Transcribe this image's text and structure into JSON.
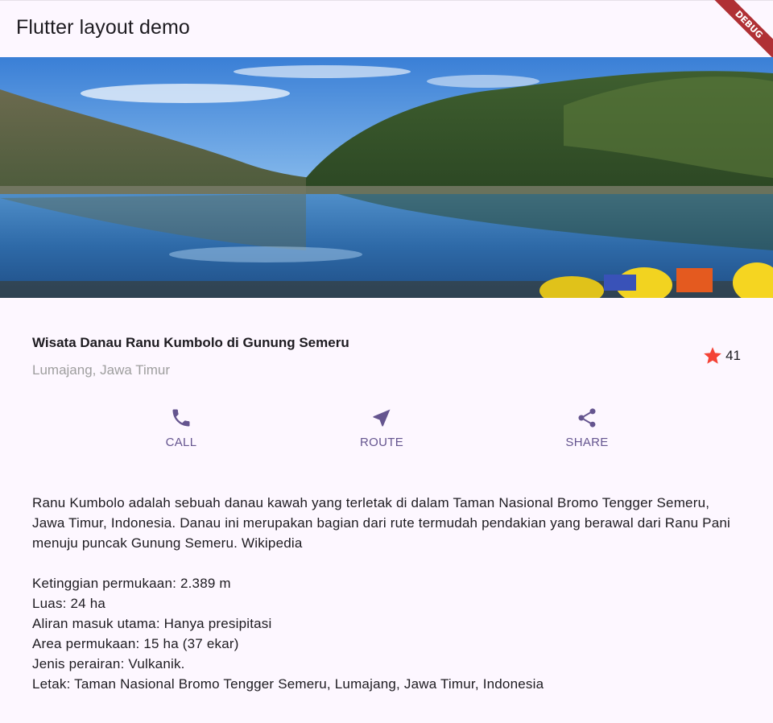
{
  "app": {
    "title": "Flutter layout demo",
    "debug_label": "DEBUG"
  },
  "hero": {
    "image_label": "lake-photo"
  },
  "place": {
    "name": "Wisata Danau Ranu Kumbolo di Gunung Semeru",
    "location": "Lumajang, Jawa Timur",
    "rating_count": "41",
    "star_color": "#f44336"
  },
  "actions": [
    {
      "icon": "phone-icon",
      "label": "CALL"
    },
    {
      "icon": "navigation-icon",
      "label": "ROUTE"
    },
    {
      "icon": "share-icon",
      "label": "SHARE"
    }
  ],
  "accent_color": "#65558f",
  "description": {
    "intro": "Ranu Kumbolo adalah sebuah danau kawah yang terletak di dalam Taman Nasional Bromo Tengger Semeru, Jawa Timur, Indonesia. Danau ini merupakan bagian dari rute termudah pendakian yang berawal dari Ranu Pani menuju puncak Gunung Semeru. Wikipedia",
    "facts": [
      "Ketinggian permukaan: 2.389 m",
      "Luas: 24 ha",
      "Aliran masuk utama: Hanya presipitasi",
      "Area permukaan: 15 ha (37 ekar)",
      "Jenis perairan: Vulkanik.",
      "Letak: Taman Nasional Bromo Tengger Semeru, Lumajang, Jawa Timur, Indonesia"
    ]
  }
}
